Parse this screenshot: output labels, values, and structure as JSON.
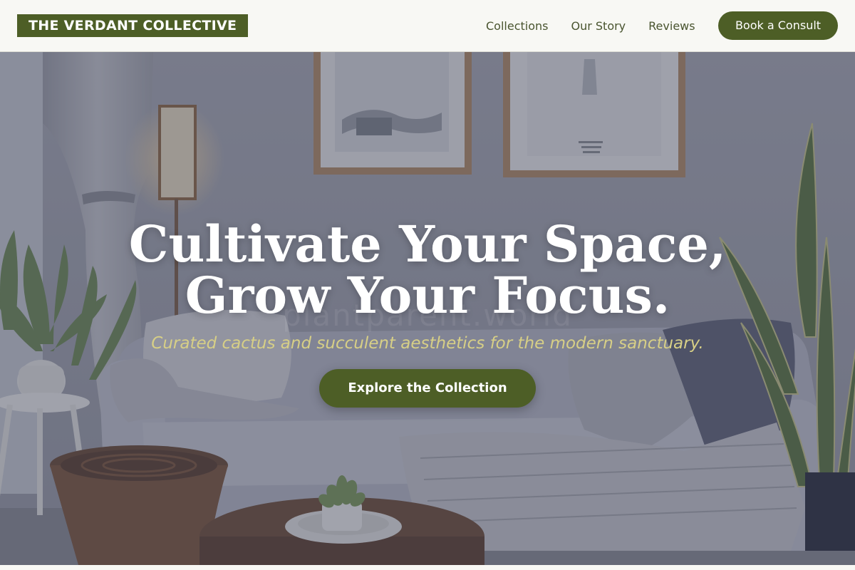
{
  "header": {
    "logo_text": "THE VERDANT COLLECTIVE",
    "nav": [
      {
        "label": "Collections"
      },
      {
        "label": "Our Story"
      },
      {
        "label": "Reviews"
      }
    ],
    "cta_label": "Book a Consult"
  },
  "hero": {
    "headline_line1": "Cultivate Your Space,",
    "headline_line2": "Grow Your Focus.",
    "subline": "Curated cactus and succulent aesthetics for the modern sanctuary.",
    "cta_label": "Explore the Collection",
    "watermark": "plantparent.world"
  },
  "colors": {
    "brand_green": "#4d5e26",
    "accent_gold": "#d7cf86",
    "header_bg": "#f8f8f4",
    "nav_text": "#4a5530"
  }
}
